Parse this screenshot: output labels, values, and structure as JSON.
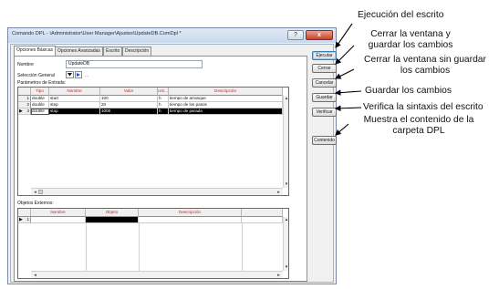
{
  "window": {
    "title": "Comando DPL - \\Administrator\\User Manager\\Ajustes\\UpdateDB.ComDpl *",
    "help_label": "?",
    "close_label": "x"
  },
  "tabs": [
    "Opciones Básicas",
    "Opciones Avanzadas",
    "Escrito",
    "Descripción"
  ],
  "form": {
    "name_label": "Nombre",
    "name_value": "UpdateDB",
    "selection_label": "Selección General",
    "params_label": "Parámetros de Entrada:",
    "external_label": "Objetos Externos:"
  },
  "params_table": {
    "columns": [
      "Tipo",
      "Nombre",
      "Valor",
      "Uni...",
      "Descripción"
    ],
    "rows": [
      {
        "num": "1",
        "tipo": "double",
        "nombre": "start",
        "valor": "100",
        "uni": "h",
        "descripcion": "tiempo de arranque"
      },
      {
        "num": "2",
        "tipo": "double",
        "nombre": "step",
        "valor": "20",
        "uni": "h",
        "descripcion": "tiempo de los pasos"
      },
      {
        "num": "3",
        "tipo": "double",
        "nombre": "stop",
        "valor": "1000",
        "uni": "h",
        "descripcion": "tiempo de parada"
      }
    ]
  },
  "external_table": {
    "columns": [
      "Nombre",
      "Objeto",
      "Descripción"
    ],
    "rows": [
      {
        "num": "1"
      }
    ]
  },
  "buttons": {
    "execute": "Ejecutar",
    "close": "Cerrar",
    "cancel": "Cancelar",
    "save": "Guardar",
    "verify": "Verificar",
    "contents": "Contenido"
  },
  "annotations": {
    "execute": "Ejecución del escrito",
    "close_line1": "Cerrar la ventana y",
    "close_line2": "guardar los cambios",
    "cancel_line1": "Cerrar la ventana sin guardar",
    "cancel_line2": "los cambios",
    "save": "Guardar los cambios",
    "verify": "Verifica la sintaxis del escrito",
    "contents_line1": "Muestra el contenido de la",
    "contents_line2": "carpeta DPL"
  },
  "colors": {
    "header_text": "#c0282d",
    "title_bar": "#c9d8ec",
    "close_button": "#c7422c"
  }
}
